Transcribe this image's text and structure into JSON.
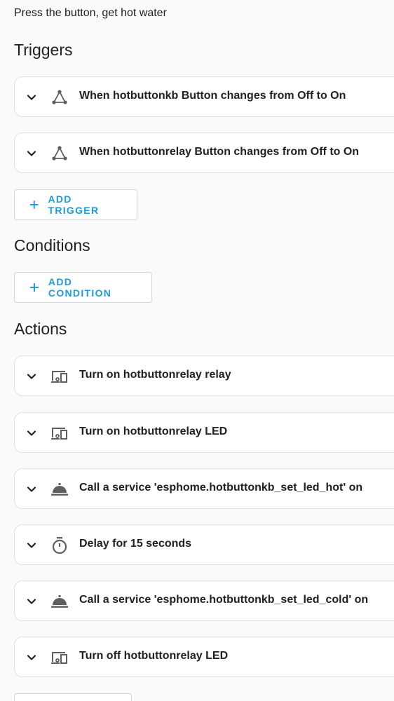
{
  "description": "Press the button, get hot water",
  "sections": {
    "triggers": {
      "title": "Triggers",
      "items": [
        {
          "label": "When hotbuttonkb Button changes from Off to On",
          "icon": "state-change-icon"
        },
        {
          "label": "When hotbuttonrelay Button changes from Off to On",
          "icon": "state-change-icon"
        }
      ],
      "add_label": "ADD TRIGGER"
    },
    "conditions": {
      "title": "Conditions",
      "add_label": "ADD CONDITION"
    },
    "actions": {
      "title": "Actions",
      "items": [
        {
          "label": "Turn on hotbuttonrelay relay",
          "icon": "devices-icon"
        },
        {
          "label": "Turn on hotbuttonrelay LED",
          "icon": "devices-icon"
        },
        {
          "label": "Call a service 'esphome.hotbuttonkb_set_led_hot' on",
          "icon": "service-bell-icon"
        },
        {
          "label": "Delay for 15 seconds",
          "icon": "timer-icon"
        },
        {
          "label": "Call a service 'esphome.hotbuttonkb_set_led_cold' on",
          "icon": "service-bell-icon"
        },
        {
          "label": "Turn off hotbuttonrelay LED",
          "icon": "devices-icon"
        }
      ]
    }
  },
  "colors": {
    "accent": "#1f9ad6",
    "icon": "#5f5f5f",
    "text": "#212121",
    "card_border": "#e0e0e0"
  }
}
